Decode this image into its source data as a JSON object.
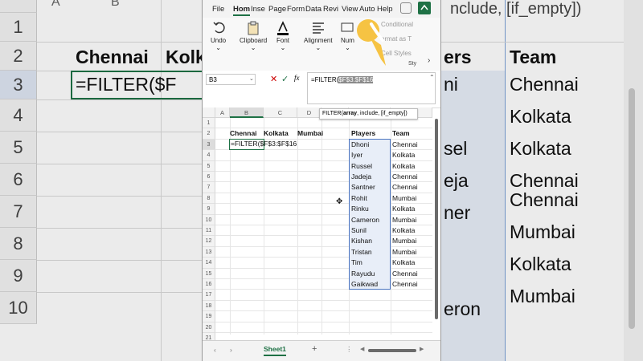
{
  "background": {
    "row_numbers": [
      "1",
      "2",
      "3",
      "4",
      "5",
      "6",
      "7",
      "8",
      "9",
      "10"
    ],
    "col_letter_a": "A",
    "col_letter_b": "B",
    "header_chennai": "Chennai",
    "header_kolkata": "Kolk",
    "formula_cell": "=FILTER($F",
    "formula_top": "nclude, [if_empty])",
    "right_header_players": "ers",
    "right_header_team": "Team",
    "right_players": [
      "ni",
      "",
      "sel",
      "eja",
      "ner",
      "",
      "",
      "eron",
      "",
      "",
      "",
      "",
      ""
    ],
    "right_teams": [
      "Chennai",
      "Kolkata",
      "Kolkata",
      "Chennai",
      "Chennai",
      "Mumbai",
      "Kolkata",
      "Mumbai"
    ]
  },
  "menu": {
    "items": [
      "File",
      "Hom",
      "Inse",
      "Page",
      "Form",
      "Data",
      "Revi",
      "View",
      "Auto",
      "Help"
    ]
  },
  "ribbon": {
    "undo": "Undo",
    "clipboard": "Clipboard",
    "font": "Font",
    "alignment": "Alignment",
    "number": "Num",
    "conditional": "Conditional",
    "format_as": "ormat as T",
    "cell_styles": "Cell Styles",
    "styles": "Sty"
  },
  "formula_bar": {
    "name_box": "B3",
    "fx": "fx",
    "formula_prefix": "=FILTER(",
    "formula_range": "$F$3:$F$16"
  },
  "tooltip": {
    "fn": "FILTER(",
    "arg1": "array",
    "rest": ", include, [if_empty])"
  },
  "grid": {
    "cols": [
      "A",
      "B",
      "C",
      "D",
      "",
      "F",
      "G"
    ],
    "row_numbers": [
      "1",
      "2",
      "3",
      "4",
      "5",
      "6",
      "7",
      "8",
      "9",
      "10",
      "11",
      "12",
      "13",
      "14",
      "15",
      "16",
      "17",
      "18",
      "19",
      "20",
      "21"
    ],
    "header_chennai": "Chennai",
    "header_kolkata": "Kolkata",
    "header_mumbai": "Mumbai",
    "header_players": "Players",
    "header_team": "Team",
    "edit_cell": "=FILTER($F$3:$F$16",
    "players": [
      "Dhoni",
      "Iyer",
      "Russel",
      "Jadeja",
      "Santner",
      "Rohit",
      "Rinku",
      "Cameron",
      "Sunil",
      "Kishan",
      "Tristan",
      "Tim",
      "Rayudu",
      "Gaikwad"
    ],
    "teams": [
      "Chennai",
      "Kolkata",
      "Kolkata",
      "Chennai",
      "Chennai",
      "Mumbai",
      "Kolkata",
      "Mumbai",
      "Kolkata",
      "Mumbai",
      "Mumbai",
      "Kolkata",
      "Chennai",
      "Chennai"
    ]
  },
  "tabs": {
    "sheet1": "Sheet1",
    "add": "+"
  }
}
